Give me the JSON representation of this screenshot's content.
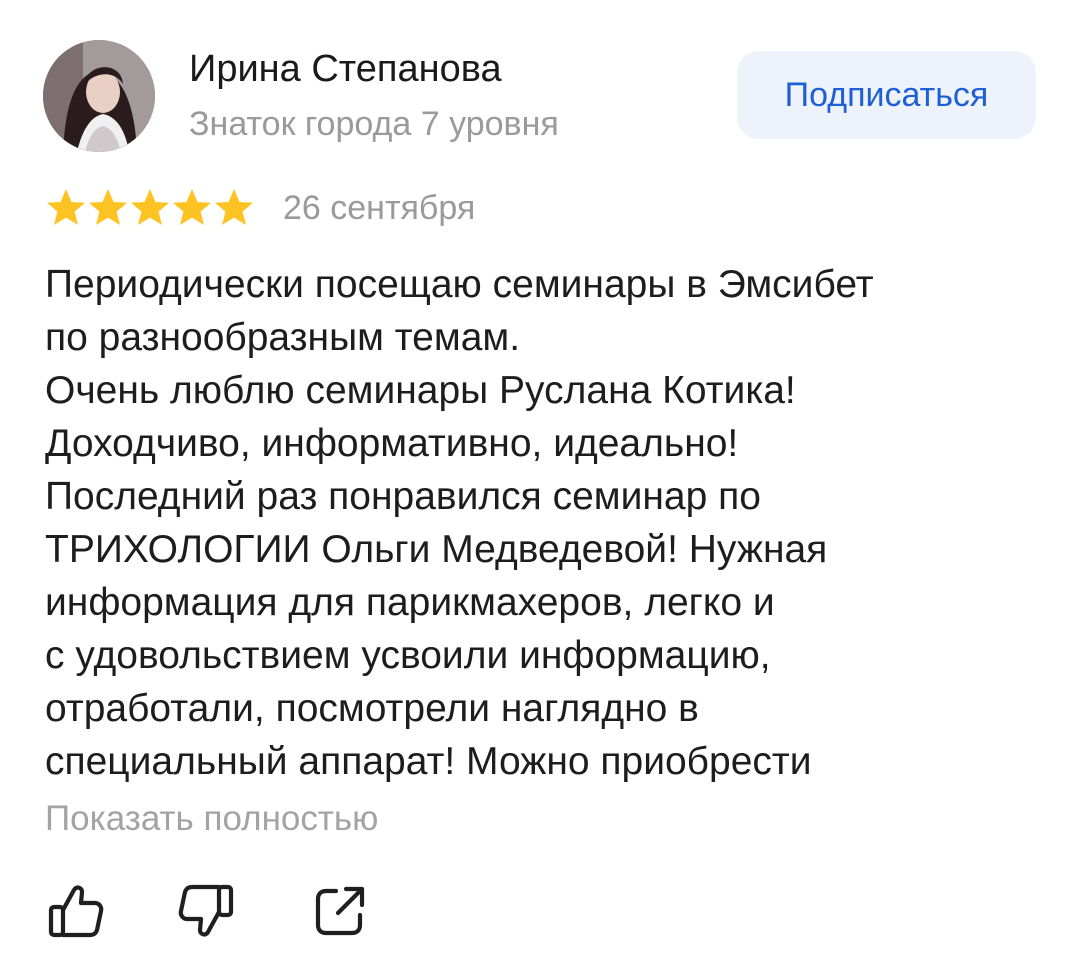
{
  "author": {
    "name": "Ирина Степанова",
    "level": "Знаток города 7 уровня",
    "avatar_icon": "user-photo"
  },
  "subscribe": {
    "label": "Подписаться",
    "color": "#1f5fd6",
    "background": "#eef3fb"
  },
  "review": {
    "rating": 5,
    "rating_max": 5,
    "star_color": "#fdc323",
    "date": "26 сентября",
    "text": "Периодически посещаю семинары в Эмсибет\nпо разнообразным темам.\nОчень люблю семинары Руслана Котика!\nДоходчиво, информативно, идеально!\nПоследний раз понравился семинар по\nТРИХОЛОГИИ Ольги  Медведевой! Нужная\nинформация для парикмахеров, легко и\nс удовольствием усвоили информацию,\nотработали, посмотрели наглядно в\nспециальный аппарат!  Можно приобрести",
    "show_more_label": "Показать полностью"
  },
  "actions": {
    "like_icon": "thumbs-up-icon",
    "dislike_icon": "thumbs-down-icon",
    "share_icon": "share-icon"
  }
}
